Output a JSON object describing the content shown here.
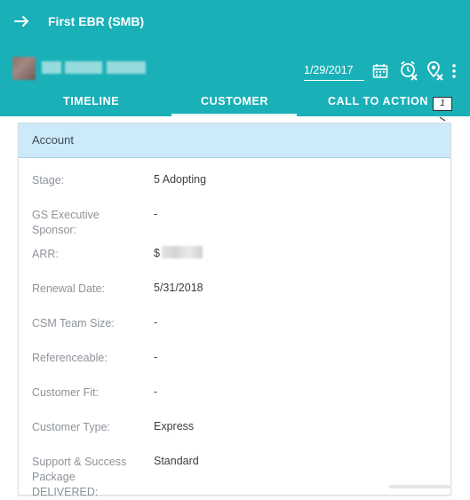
{
  "header": {
    "title": "First EBR (SMB)",
    "back_icon": "arrow-right-icon",
    "date_value": "1/29/2017",
    "icons": [
      "calendar-icon",
      "alarm-off-icon",
      "location-off-icon",
      "more-vertical-icon"
    ]
  },
  "tabs": [
    {
      "label": "TIMELINE",
      "active": false
    },
    {
      "label": "CUSTOMER",
      "active": true
    },
    {
      "label": "CALL TO ACTION",
      "active": false,
      "badge": "1"
    }
  ],
  "card": {
    "title": "Account",
    "rows": [
      {
        "label": "Stage:",
        "value": "5 Adopting"
      },
      {
        "label": "GS Executive Sponsor:",
        "value": "-"
      },
      {
        "label": "ARR:",
        "value": "$"
      },
      {
        "label": "Renewal Date:",
        "value": "5/31/2018"
      },
      {
        "label": "CSM Team Size:",
        "value": "-"
      },
      {
        "label": "Referenceable:",
        "value": "-"
      },
      {
        "label": "Customer Fit:",
        "value": "-"
      },
      {
        "label": "Customer Type:",
        "value": "Express"
      },
      {
        "label": "Support & Success Package DELIVERED:",
        "value": "Standard"
      }
    ]
  },
  "colors": {
    "header_bg": "#1ab0b8",
    "card_header_bg": "#cdeafa",
    "label_text": "#8d9399",
    "value_text": "#3b3f44"
  }
}
